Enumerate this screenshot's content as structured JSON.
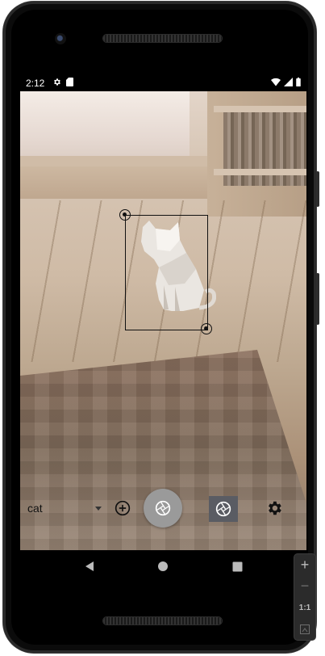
{
  "status_bar": {
    "time": "2:12",
    "left_icons": [
      "settings-icon",
      "sd-card-icon"
    ],
    "right_icons": [
      "wifi-icon",
      "signal-icon",
      "battery-icon"
    ]
  },
  "camera_view": {
    "detected_object": "cat-figurine"
  },
  "controls": {
    "label_selected": "cat",
    "add_icon": "add-circle-icon",
    "shutter_icon": "camera-shutter-icon",
    "mode_icon": "camera-shutter-icon",
    "settings_icon": "gear-icon",
    "shutter_color": "#9a9a9a",
    "mode_bg_color": "#5a5c63"
  },
  "navigation": {
    "back_icon": "back-triangle-icon",
    "home_icon": "home-circle-icon",
    "recents_icon": "recents-square-icon"
  },
  "emulator_toolbar": {
    "zoom_in": "+",
    "zoom_out": "−",
    "ratio": "1:1",
    "fit_icon": "fit-screen-icon"
  }
}
